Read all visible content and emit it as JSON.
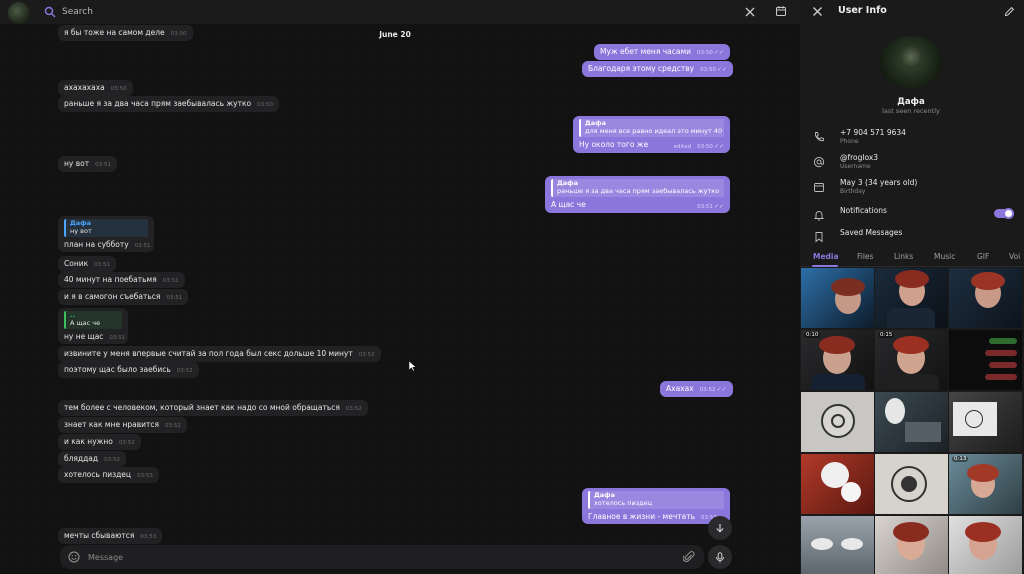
{
  "search": {
    "placeholder": "Search"
  },
  "chat": {
    "date": "June 20",
    "messages": [
      {
        "text": "я бы тоже на самом деле",
        "time": "03:50"
      },
      {
        "text": "Муж ебет меня часами",
        "time": "03:50"
      },
      {
        "text": "Благодаря этому средству",
        "time": "03:50"
      },
      {
        "text": "ахахахаха",
        "time": "03:50"
      },
      {
        "text": "раньше я за два часа прям заебывалась жутко",
        "time": "03:50"
      },
      {
        "reply_name": "Дафа",
        "reply_text": "для меня все равно идеал это минут 40",
        "text": "Ну около того же",
        "time": "03:50",
        "edited": "edited"
      },
      {
        "text": "ну вот",
        "time": "03:51"
      },
      {
        "reply_name": "Дафа",
        "reply_text": "раньше я за два часа прям заебывалась жутко",
        "text": "А щас че",
        "time": "03:51"
      },
      {
        "reply_name": "Дафа",
        "reply_text": "ну вот",
        "text": "план на субботу",
        "time": "03:51"
      },
      {
        "text": "Соник",
        "time": "03:51"
      },
      {
        "text": "40 минут на поебатьмя",
        "time": "03:51"
      },
      {
        "text": "и я в самогон съебаться",
        "time": "03:51"
      },
      {
        "reply_name": "..",
        "reply_text": "А щас че",
        "text": "ну не щас",
        "time": "03:51"
      },
      {
        "text": "извините у меня впервые считай за пол года был секс дольше 10 минут",
        "time": "03:52"
      },
      {
        "text": "поэтому щас было заебись",
        "time": "03:52"
      },
      {
        "text": "Ахахах",
        "time": "03:52"
      },
      {
        "text": "тем более с человеком, который знает как надо со мной обращаться",
        "time": "03:52"
      },
      {
        "text": "знает как мне нравится",
        "time": "03:52"
      },
      {
        "text": "и как нужно",
        "time": "03:52"
      },
      {
        "text": "бляддад",
        "time": "03:52"
      },
      {
        "text": "хотелось пиздец",
        "time": "03:53"
      },
      {
        "reply_name": "Дафа",
        "reply_text": "хотелось пиздец",
        "text": "Главное в жизни - мечтать",
        "time": "03:53"
      },
      {
        "text": "мечты сбываются",
        "time": "03:53"
      }
    ]
  },
  "composer": {
    "placeholder": "Message"
  },
  "panel": {
    "title": "User Info",
    "name": "Дафа",
    "status": "last seen recently",
    "phone": "+7 904 571 9634",
    "phone_label": "Phone",
    "username": "@froglox3",
    "username_label": "Username",
    "birthday": "May 3 (34 years old)",
    "birthday_label": "Birthday",
    "notifications": "Notifications",
    "saved": "Saved Messages",
    "tabs": [
      "Media",
      "Files",
      "Links",
      "Music",
      "GIF",
      "Voi"
    ],
    "durations": [
      "0:10",
      "0:15",
      "0:13"
    ]
  },
  "colors": {
    "accent": "#8b77dc",
    "outgoing": "#8b77dc",
    "incoming": "#222224",
    "panel_bg": "#1a1a1b"
  }
}
